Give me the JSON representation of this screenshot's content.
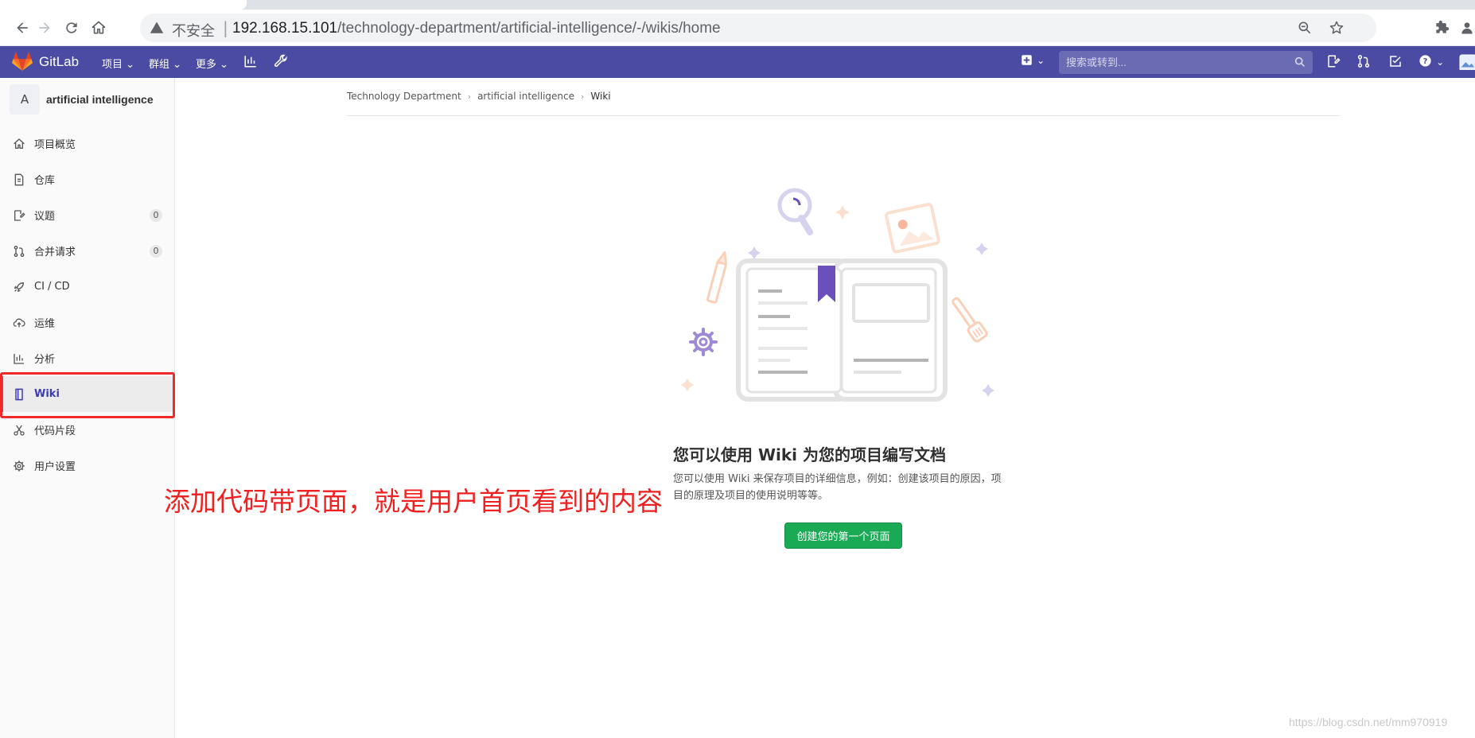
{
  "browser": {
    "security_label": "不安全",
    "url_host": "192.168.15.101",
    "url_path": "/technology-department/artificial-intelligence/-/wikis/home"
  },
  "header": {
    "brand": "GitLab",
    "menus": [
      "项目",
      "群组",
      "更多"
    ],
    "search_placeholder": "搜索或转到...",
    "bg_color": "#4b4ba3"
  },
  "sidebar": {
    "project_avatar_letter": "A",
    "project_name": "artificial intelligence",
    "items": [
      {
        "label": "项目概览",
        "icon": "home-icon"
      },
      {
        "label": "仓库",
        "icon": "document-icon"
      },
      {
        "label": "议题",
        "icon": "issues-icon",
        "badge": "0"
      },
      {
        "label": "合并请求",
        "icon": "merge-request-icon",
        "badge": "0"
      },
      {
        "label": "CI / CD",
        "icon": "rocket-icon"
      },
      {
        "label": "运维",
        "icon": "cloud-icon"
      },
      {
        "label": "分析",
        "icon": "chart-icon"
      },
      {
        "label": "Wiki",
        "icon": "book-icon",
        "active": true
      },
      {
        "label": "代码片段",
        "icon": "scissors-icon"
      },
      {
        "label": "用户设置",
        "icon": "gear-icon"
      }
    ]
  },
  "breadcrumb": [
    "Technology Department",
    "artificial intelligence",
    "Wiki"
  ],
  "empty_state": {
    "title": "您可以使用 Wiki 为您的项目编写文档",
    "description": "您可以使用 Wiki 来保存项目的详细信息，例如：创建该项目的原因，项目的原理及项目的使用说明等等。",
    "button_label": "创建您的第一个页面",
    "button_color": "#1aaa55"
  },
  "annotation_text": "添加代码带页面，就是用户首页看到的内容",
  "watermark": "https://blog.csdn.net/mm970919"
}
